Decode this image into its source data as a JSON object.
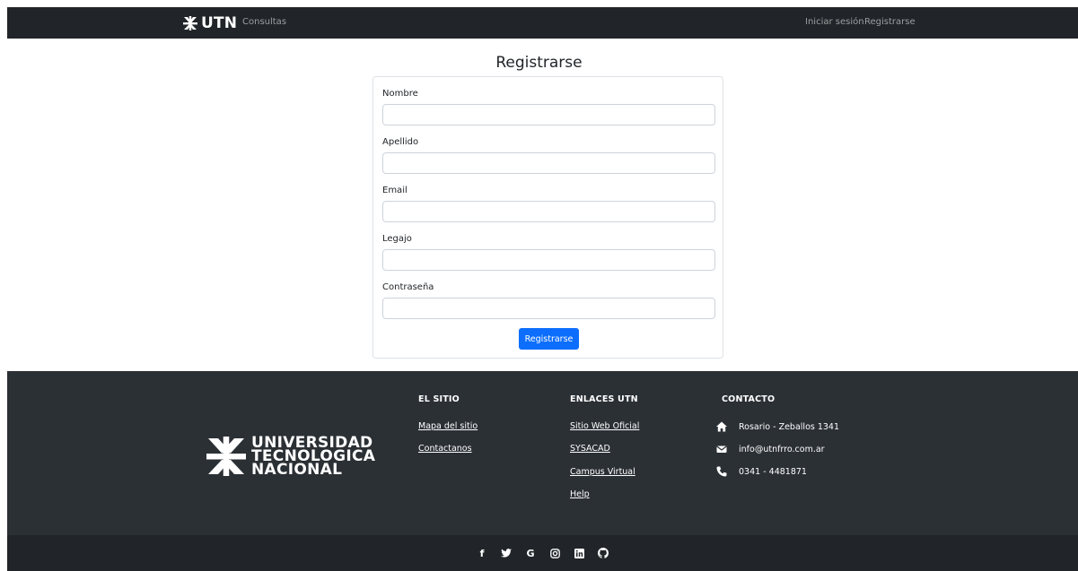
{
  "navbar": {
    "brand": "UTN",
    "links": {
      "consultas": "Consultas",
      "login": "Iniciar sesión",
      "register": "Registrarse"
    }
  },
  "form": {
    "title": "Registrarse",
    "fields": [
      {
        "label": "Nombre",
        "value": "",
        "placeholder": ""
      },
      {
        "label": "Apellido",
        "value": "",
        "placeholder": ""
      },
      {
        "label": "Email",
        "value": "",
        "placeholder": ""
      },
      {
        "label": "Legajo",
        "value": "",
        "placeholder": ""
      },
      {
        "label": "Contraseña",
        "value": "",
        "placeholder": ""
      }
    ],
    "submit_label": "Registrarse"
  },
  "footer": {
    "logo": {
      "lines": [
        "UNIVERSIDAD",
        "TECNOLOGICA",
        "NACIONAL"
      ]
    },
    "el_sitio": {
      "title": "EL SITIO",
      "links": [
        "Mapa del sitio",
        "Contactanos"
      ]
    },
    "enlaces": {
      "title": "ENLACES UTN",
      "links": [
        "Sitio Web Oficial",
        "SYSACAD",
        "Campus Virtual",
        "Help"
      ]
    },
    "contacto": {
      "title": "CONTACTO",
      "address": "Rosario - Zeballos 1341",
      "email": "info@utnfrro.com.ar",
      "phone": "0341 - 4481871"
    },
    "social": [
      "facebook-icon",
      "twitter-icon",
      "google-icon",
      "instagram-icon",
      "linkedin-icon",
      "github-icon"
    ]
  },
  "colors": {
    "navbar_bg": "#212529",
    "footer_bg": "#2b3035",
    "footer_bottom_bg": "#212529",
    "primary": "#0d6efd"
  }
}
